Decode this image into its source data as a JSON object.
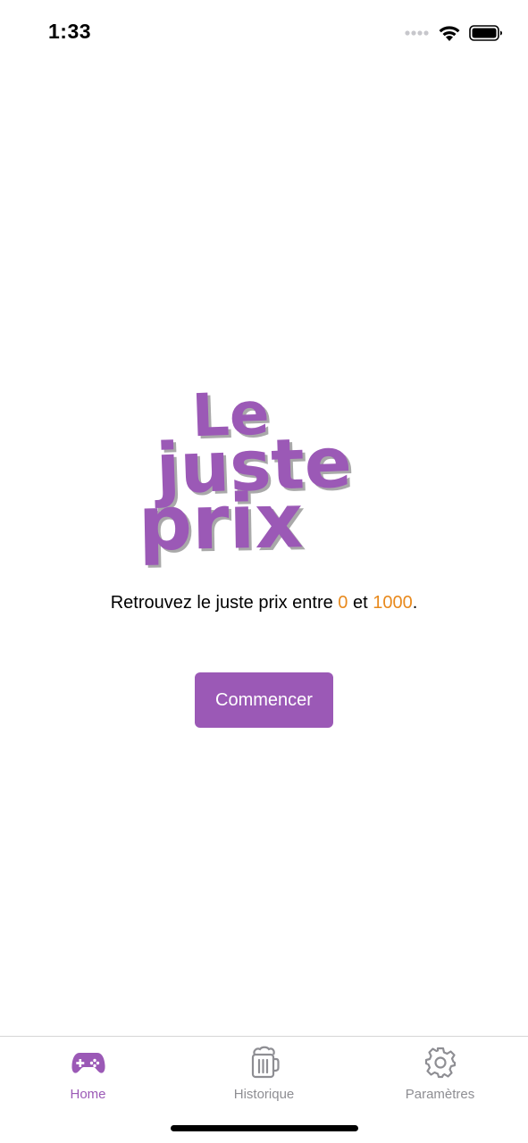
{
  "status_bar": {
    "time": "1:33"
  },
  "logo": {
    "line1": "Le",
    "line2": "juste",
    "line3": "prix",
    "color": "#9b59b6"
  },
  "tagline": {
    "prefix": "Retrouvez le juste prix entre ",
    "min": "0",
    "middle": " et ",
    "max": "1000",
    "suffix": "."
  },
  "start_button": {
    "label": "Commencer"
  },
  "tab_bar": {
    "tabs": [
      {
        "label": "Home",
        "icon": "gamepad-icon",
        "active": true
      },
      {
        "label": "Historique",
        "icon": "beer-mug-icon",
        "active": false
      },
      {
        "label": "Paramètres",
        "icon": "gear-icon",
        "active": false
      }
    ]
  },
  "colors": {
    "accent": "#9b59b6",
    "number_highlight": "#e8891c",
    "inactive_tab": "#8e8e93"
  }
}
